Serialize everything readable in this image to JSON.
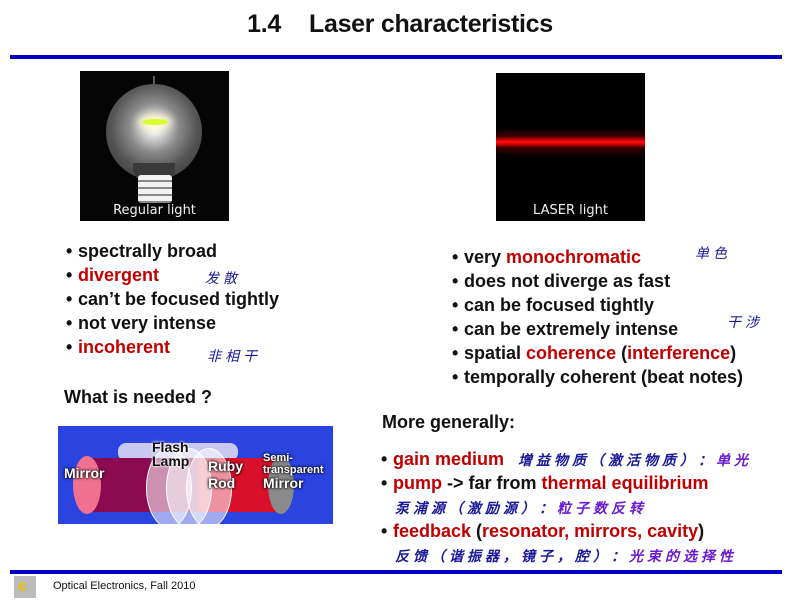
{
  "title": {
    "number": "1.4",
    "text": "Laser characteristics"
  },
  "images": {
    "regular_caption": "Regular light",
    "laser_caption": "LASER light"
  },
  "regular_list": [
    {
      "parts": [
        {
          "t": "spectrally broad",
          "c": "black"
        }
      ]
    },
    {
      "parts": [
        {
          "t": "divergent",
          "c": "red"
        }
      ],
      "cn": "发散"
    },
    {
      "parts": [
        {
          "t": "can’t be focused tightly",
          "c": "black"
        }
      ]
    },
    {
      "parts": [
        {
          "t": "not very intense",
          "c": "black"
        }
      ]
    },
    {
      "parts": [
        {
          "t": "incoherent",
          "c": "red"
        }
      ],
      "cn": "非相干"
    }
  ],
  "what_needed": "What is needed ?",
  "laser_list": [
    {
      "parts": [
        {
          "t": "very ",
          "c": "black"
        },
        {
          "t": "monochromatic",
          "c": "red"
        }
      ]
    },
    {
      "parts": [
        {
          "t": "does not diverge as fast",
          "c": "black"
        }
      ]
    },
    {
      "parts": [
        {
          "t": "can be focused tightly",
          "c": "black"
        }
      ]
    },
    {
      "parts": [
        {
          "t": "can be extremely intense",
          "c": "black"
        }
      ]
    },
    {
      "parts": [
        {
          "t": "spatial ",
          "c": "black"
        },
        {
          "t": "coherence",
          "c": "red"
        },
        {
          "t": " (",
          "c": "black"
        },
        {
          "t": "interference",
          "c": "red"
        },
        {
          "t": ")",
          "c": "black"
        }
      ]
    },
    {
      "parts": [
        {
          "t": "temporally coherent (beat notes)",
          "c": "black"
        }
      ]
    }
  ],
  "annotations": {
    "monochromatic_cn": "单色",
    "interference_cn": "干涉"
  },
  "diagram": {
    "mirror": "Mirror",
    "flash_lamp": [
      "Flash",
      "Lamp"
    ],
    "ruby_rod": [
      "Ruby",
      "Rod"
    ],
    "semi_mirror": [
      "Semi-",
      "transparent",
      "Mirror"
    ]
  },
  "more_generally": "More generally:",
  "general_list": [
    {
      "parts": [
        {
          "t": "gain medium",
          "c": "red"
        }
      ],
      "cn": "增益物质（激活物质）：",
      "cn2": "单光"
    },
    {
      "parts": [
        {
          "t": "pump",
          "c": "red"
        },
        {
          "t": " -> far from ",
          "c": "black"
        },
        {
          "t": "thermal equilibrium",
          "c": "red"
        }
      ]
    },
    {
      "cn_line": "泵浦源（激励源）：",
      "cn_line2": "粒子数反转"
    },
    {
      "parts": [
        {
          "t": "feedback",
          "c": "red"
        },
        {
          "t": " (",
          "c": "black"
        },
        {
          "t": "resonator, mirrors, cavity",
          "c": "red"
        },
        {
          "t": ")",
          "c": "black"
        }
      ]
    },
    {
      "cn_line": "反馈（谐振器，镜子，腔）：",
      "cn_line2": "光束的选择性"
    }
  ],
  "footer": {
    "text": "Optical Electronics, Fall 2010",
    "logo_icon": "yellow-figure-logo"
  },
  "colors": {
    "rule": "#0000c0",
    "accent_red": "#c00000",
    "cn_blue": "#1a1a9a",
    "cn_purple": "#6a1bd0"
  }
}
